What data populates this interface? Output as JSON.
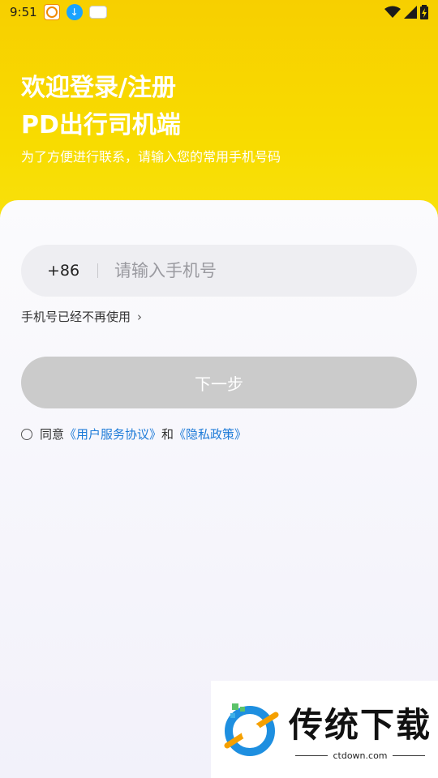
{
  "status_bar": {
    "time": "9:51"
  },
  "header": {
    "title_line1": "欢迎登录/注册",
    "title_line2": "PD出行司机端",
    "subtitle": "为了方便进行联系，请输入您的常用手机号码"
  },
  "login": {
    "country_code": "+86",
    "phone_placeholder": "请输入手机号",
    "phone_value": "",
    "no_longer_used": "手机号已经不再使用",
    "next_button": "下一步",
    "agree_prefix": "同意",
    "user_agreement": "《用户服务协议》",
    "and": "和",
    "privacy_policy": "《隐私政策》"
  },
  "watermark": {
    "brand": "传统下载",
    "url": "ctdown.com"
  },
  "colors": {
    "header_yellow": "#f8d800",
    "link_blue": "#1e7bd8",
    "button_disabled": "#cbcbcb"
  }
}
